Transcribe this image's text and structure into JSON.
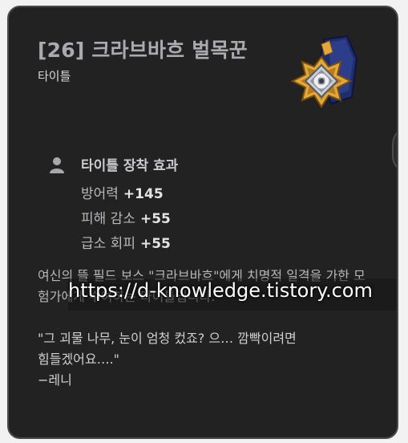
{
  "item": {
    "title": "[26] 크라브바흐 벌목꾼",
    "category": "타이틀",
    "emblem_icon": "knot-medal-icon"
  },
  "effect": {
    "icon": "person-icon",
    "title": "타이틀 장착 효과",
    "stats": [
      {
        "label": "방어력",
        "value": "+145"
      },
      {
        "label": "피해 감소",
        "value": "+55"
      },
      {
        "label": "급소 회피",
        "value": "+55"
      }
    ]
  },
  "description": "여신의 뜰 필드 보스 \"크라브바흐\"에게 치명적 일격을 가한 모험가에게 수여하는 타이틀입니다.",
  "quote": {
    "line1": "\"그 괴물 나무, 눈이 엄청 컸죠? 으… 깜빡이려면",
    "line2": "힘들겠어요….\"",
    "author": "−레니"
  },
  "watermark": "https://d-knowledge.tistory.com",
  "swap_button": {
    "icon": "swap-arrows-icon"
  },
  "colors": {
    "card_bg": "#222223",
    "border": "#4b4b4d",
    "title": "#a9abb1",
    "medal_gold": "#e2a93a",
    "medal_blue": "#1f2d6b"
  }
}
